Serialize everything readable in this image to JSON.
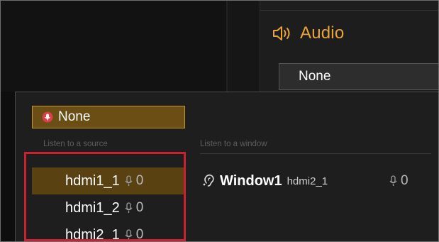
{
  "audio": {
    "title": "Audio",
    "selected_value": "None",
    "icon": "speaker-icon"
  },
  "popup": {
    "none_option_label": "None",
    "source_section_label": "Listen to a source",
    "window_section_label": "Listen to a window",
    "sources": [
      {
        "name": "hdmi1_1",
        "count": "0",
        "selected": true
      },
      {
        "name": "hdmi1_2",
        "count": "0",
        "selected": false
      },
      {
        "name": "hdmi2_1",
        "count": "0",
        "selected": false
      }
    ],
    "windows": [
      {
        "name": "Window1",
        "source": "hdmi2_1",
        "count": "0"
      }
    ]
  },
  "colors": {
    "accent": "#e9a43a",
    "selected_bg": "#5a4112",
    "highlight": "#c8212f"
  }
}
